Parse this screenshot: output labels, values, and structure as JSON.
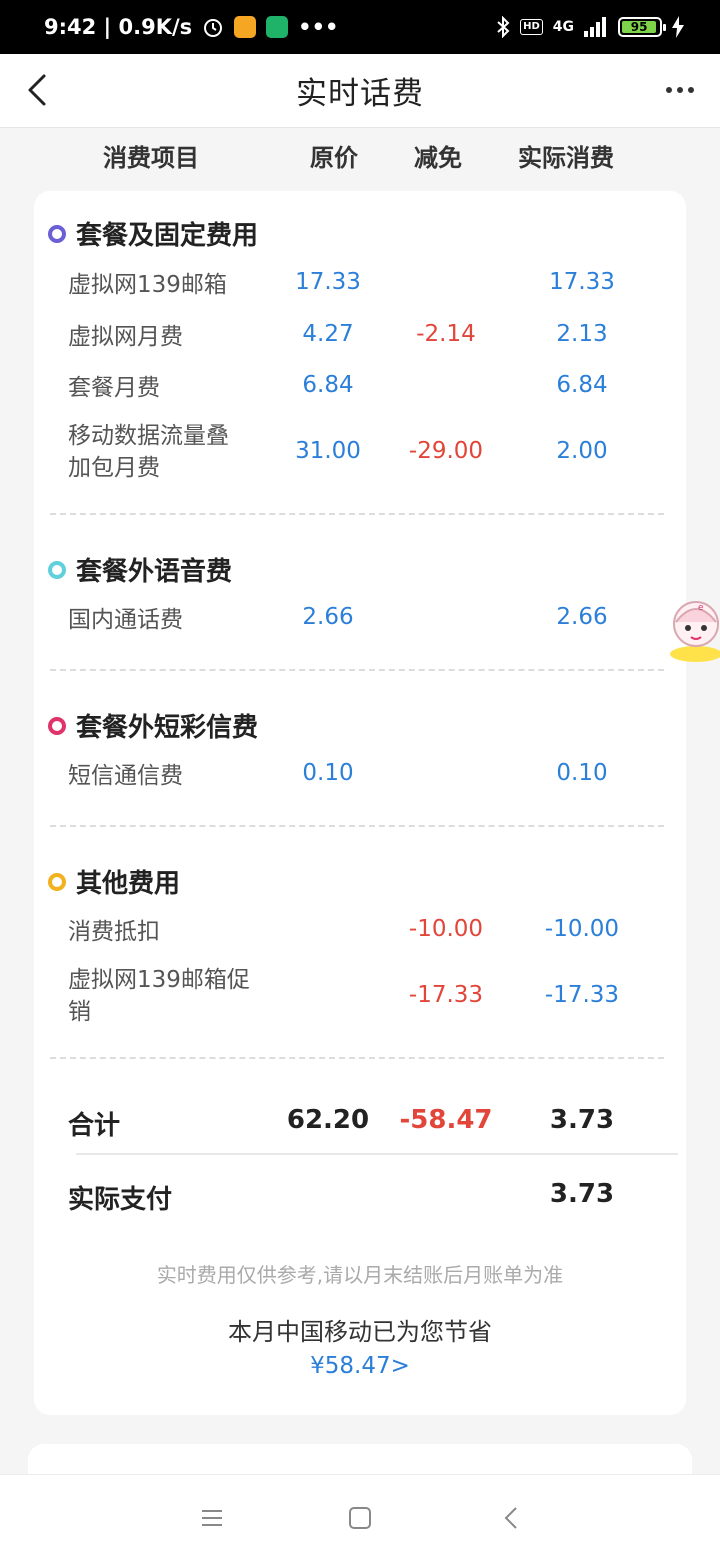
{
  "status_bar": {
    "time_speed": "9:42 | 0.9K/s",
    "network": "4G",
    "hd": "HD",
    "battery": "95",
    "icons": [
      "alarm-icon",
      "app-icon-orange",
      "app-icon-green",
      "more-dots-icon",
      "bluetooth-icon",
      "hd-icon",
      "signal-icon",
      "battery-icon",
      "charging-icon"
    ]
  },
  "header": {
    "title": "实时话费",
    "back_icon": "chevron-left-icon",
    "more_icon": "more-horizontal-icon"
  },
  "columns": {
    "item": "消费项目",
    "original": "原价",
    "discount": "减免",
    "actual": "实际消费"
  },
  "sections": [
    {
      "title": "套餐及固定费用",
      "dot_color": "#6b5fd6",
      "rows": [
        {
          "name": "虚拟网139邮箱",
          "original": "17.33",
          "discount": "",
          "actual": "17.33"
        },
        {
          "name": "虚拟网月费",
          "original": "4.27",
          "discount": "-2.14",
          "actual": "2.13"
        },
        {
          "name": "套餐月费",
          "original": "6.84",
          "discount": "",
          "actual": "6.84"
        },
        {
          "name_line1": "移动数据流量叠",
          "name_line2": "加包月费",
          "original": "31.00",
          "discount": "-29.00",
          "actual": "2.00"
        }
      ]
    },
    {
      "title": "套餐外语音费",
      "dot_color": "#5fd0dc",
      "rows": [
        {
          "name": "国内通话费",
          "original": "2.66",
          "discount": "",
          "actual": "2.66"
        }
      ]
    },
    {
      "title": "套餐外短彩信费",
      "dot_color": "#e0336a",
      "rows": [
        {
          "name": "短信通信费",
          "original": "0.10",
          "discount": "",
          "actual": "0.10"
        }
      ]
    },
    {
      "title": "其他费用",
      "dot_color": "#f0b21e",
      "rows": [
        {
          "name": "消费抵扣",
          "original": "",
          "discount": "-10.00",
          "actual": "-10.00"
        },
        {
          "name_line1": "虚拟网139邮箱促",
          "name_line2": "销",
          "original": "",
          "discount": "-17.33",
          "actual": "-17.33"
        }
      ]
    }
  ],
  "totals": {
    "label": "合计",
    "original": "62.20",
    "discount": "-58.47",
    "actual": "3.73"
  },
  "payment": {
    "label": "实际支付",
    "actual": "3.73"
  },
  "footer": {
    "note": "实时费用仅供参考,请以月末结账后月账单为准",
    "saved_text": "本月中国移动已为您节省",
    "saved_link": "¥58.47>"
  },
  "colors": {
    "blue": "#2b7fd8",
    "red": "#e2453a"
  }
}
